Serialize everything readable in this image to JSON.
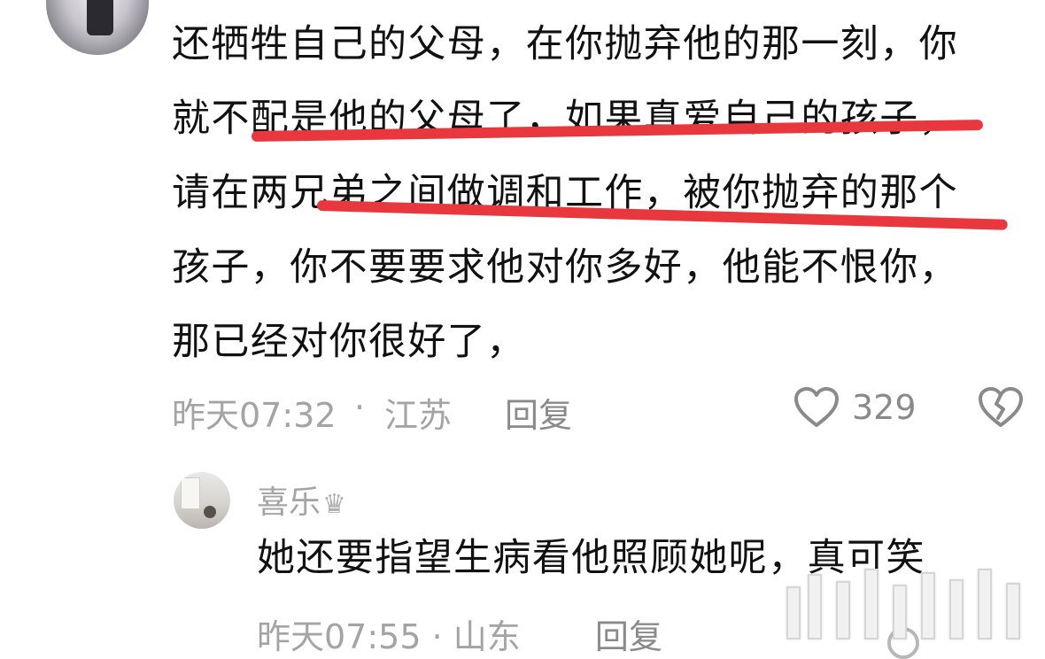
{
  "comment": {
    "lines": [
      "还牺牲自己的父母，在你抛弃他的那一刻，你",
      "就不配是他的父母了，如果真爱自己的孩子，",
      "请在两兄弟之间做调和工作，被你抛弃的那个",
      "孩子，你不要要求他对你多好，他能不恨你，",
      "那已经对你很好了，"
    ],
    "time": "昨天07:32",
    "separator": "·",
    "location": "江苏",
    "reply_label": "回复",
    "like_count": "329",
    "icons": {
      "like": "heart-outline-icon",
      "dislike": "broken-heart-icon"
    },
    "highlight_color": "#e9383d"
  },
  "reply": {
    "author": "喜乐",
    "author_badge": "♛",
    "text": "她还要指望生病看他照顾她呢，真可笑",
    "time": "昨天07:55",
    "separator": "·",
    "location": "山东",
    "reply_label": "回复"
  }
}
